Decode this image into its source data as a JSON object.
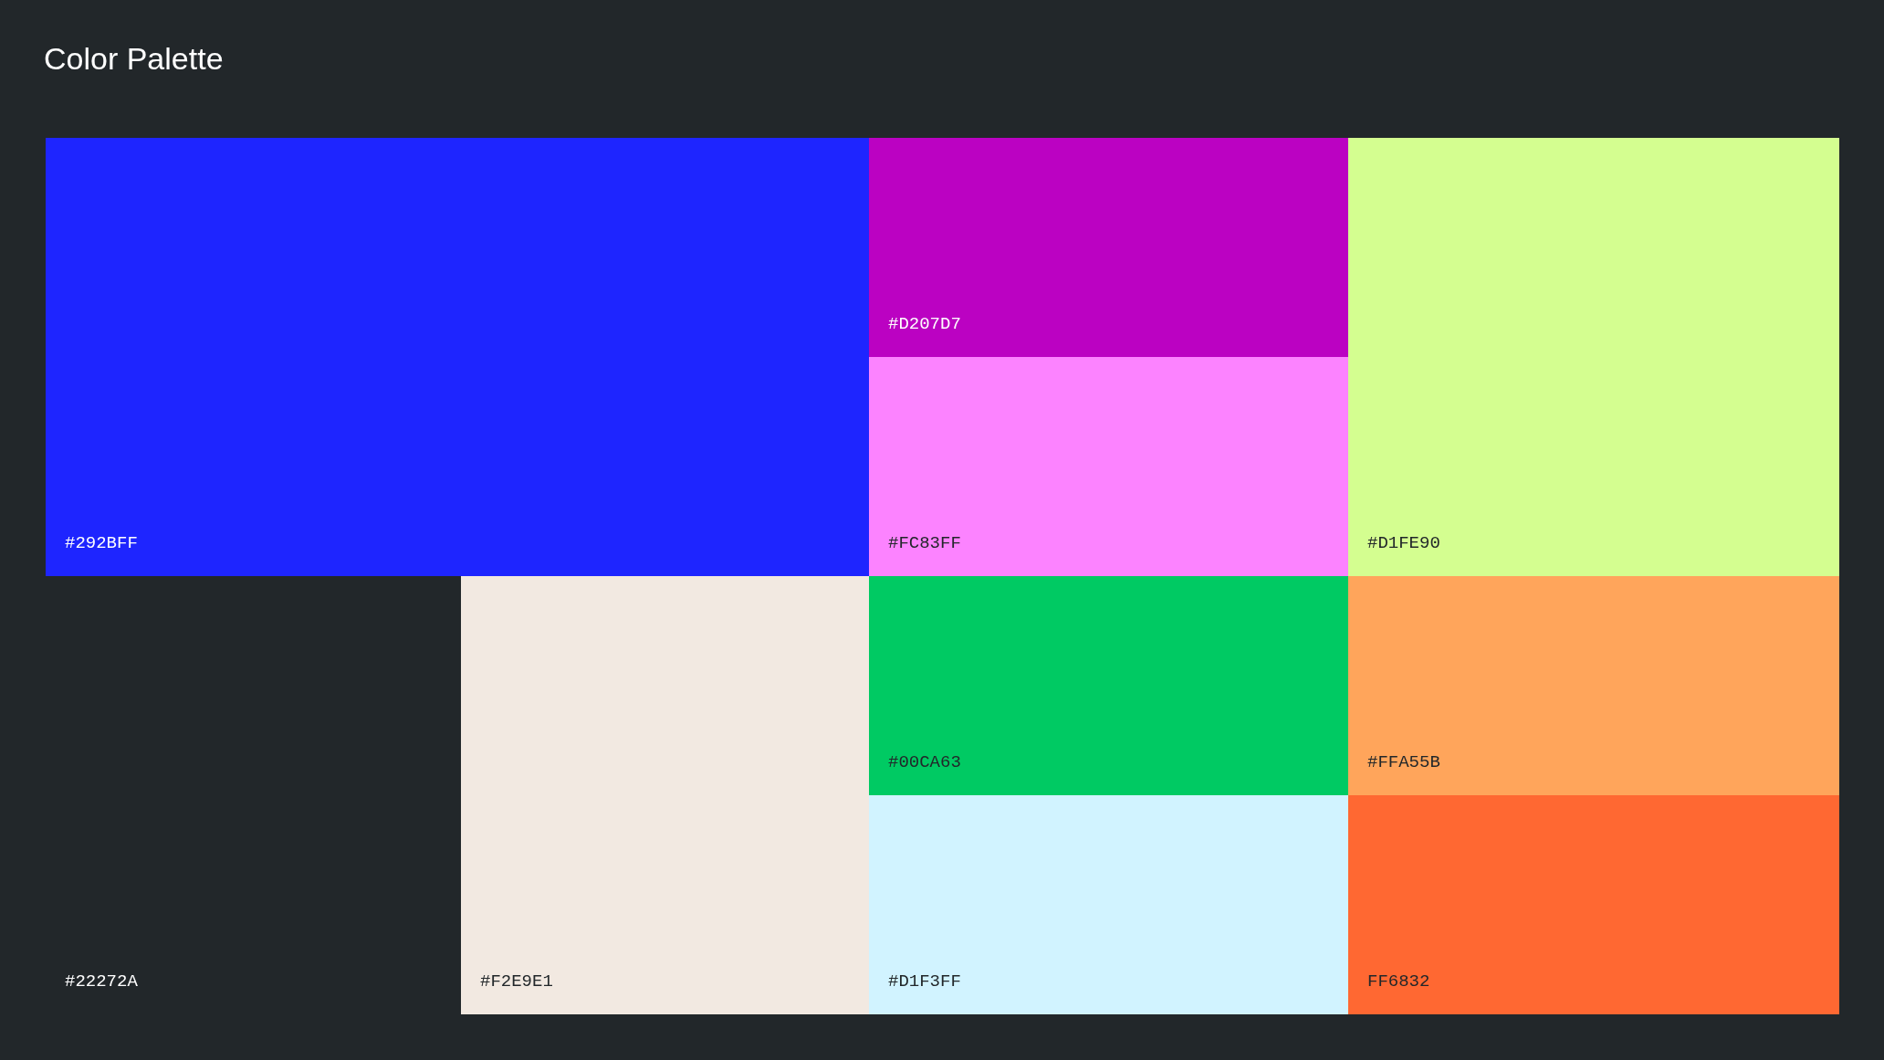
{
  "title": "Color Palette",
  "swatches": [
    {
      "label": "#292BFF",
      "color": "#1e25ff",
      "light_label": true
    },
    {
      "label": "#D207D7",
      "color": "#bb02c2",
      "light_label": true
    },
    {
      "label": "#FC83FF",
      "color": "#fc83ff",
      "light_label": false
    },
    {
      "label": "#D1FE90",
      "color": "#d4fe90",
      "light_label": false
    },
    {
      "label": "#22272A",
      "color": "#22272a",
      "light_label": true
    },
    {
      "label": "#F2E9E1",
      "color": "#f2e9e1",
      "light_label": false
    },
    {
      "label": "#00CA63",
      "color": "#00ca63",
      "light_label": false
    },
    {
      "label": "#FFA55B",
      "color": "#ffa55b",
      "light_label": false
    },
    {
      "label": "#D1F3FF",
      "color": "#d1f3ff",
      "light_label": false
    },
    {
      "label": "FF6832",
      "color": "#ff6832",
      "light_label": false
    }
  ]
}
